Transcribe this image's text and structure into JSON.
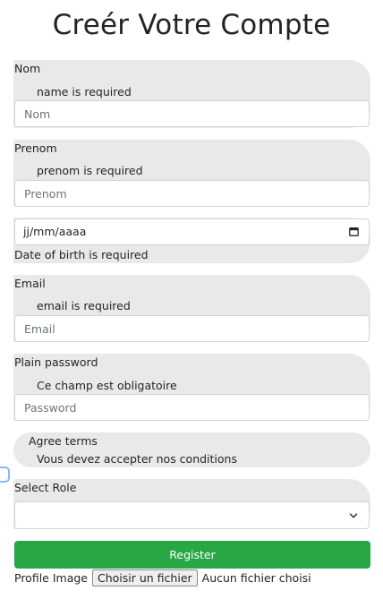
{
  "title": "Creér Votre Compte",
  "nom": {
    "label": "Nom",
    "error": "name is required",
    "placeholder": "Nom"
  },
  "prenom": {
    "label": "Prenom",
    "error": "prenom is required",
    "placeholder": "Prenom"
  },
  "birth": {
    "value": "jj/mm/aaaa",
    "error": "Date of birth is required"
  },
  "email": {
    "label": "Email",
    "error": "email is required",
    "placeholder": "Email"
  },
  "password": {
    "label": "Plain password",
    "error": "Ce champ est obligatoire",
    "placeholder": "Password"
  },
  "terms": {
    "label": "Agree terms",
    "error": "Vous devez accepter nos conditions"
  },
  "role": {
    "label": "Select Role",
    "selected": ""
  },
  "register_label": "Register",
  "profile": {
    "label": "Profile Image",
    "button": "Choisir un fichier",
    "status": "Aucun fichier choisi"
  },
  "colors": {
    "accent": "#28a745",
    "group_bg": "#e9e9e9",
    "focus": "#86b7fe"
  },
  "icons": {
    "date_picker": "calendar-icon",
    "select": "chevron-down-icon"
  }
}
